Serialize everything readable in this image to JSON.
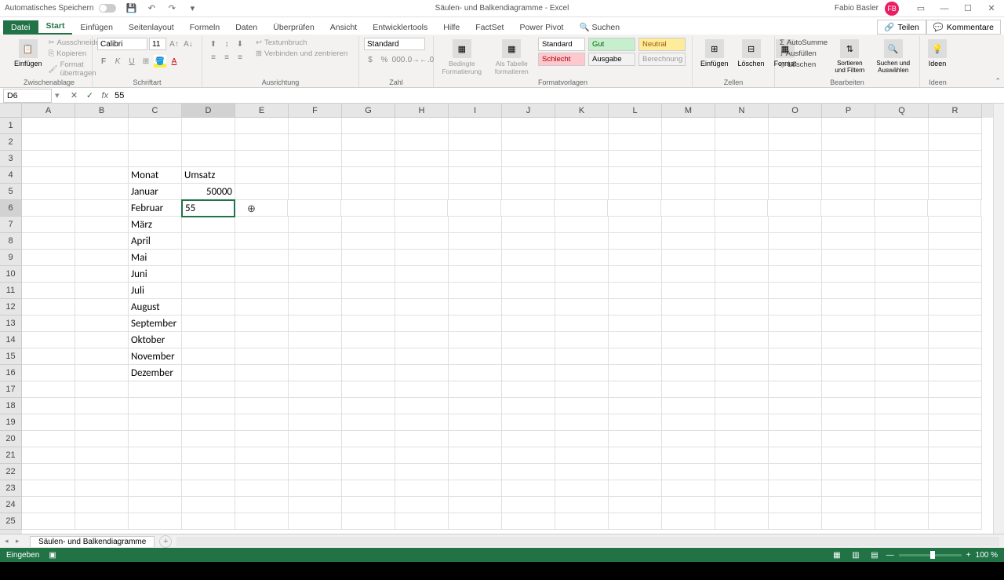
{
  "titlebar": {
    "autosave": "Automatisches Speichern",
    "doc_title": "Säulen- und Balkendiagramme - Excel",
    "user_name": "Fabio Basler",
    "user_initials": "FB"
  },
  "tabs": {
    "file": "Datei",
    "items": [
      "Start",
      "Einfügen",
      "Seitenlayout",
      "Formeln",
      "Daten",
      "Überprüfen",
      "Ansicht",
      "Entwicklertools",
      "Hilfe",
      "FactSet",
      "Power Pivot"
    ],
    "search_icon": "🔍",
    "search": "Suchen",
    "share": "Teilen",
    "comments": "Kommentare"
  },
  "ribbon": {
    "clipboard": {
      "label": "Zwischenablage",
      "paste": "Einfügen",
      "cut": "Ausschneiden",
      "copy": "Kopieren",
      "format": "Format übertragen"
    },
    "font": {
      "label": "Schriftart",
      "name": "Calibri",
      "size": "11"
    },
    "align": {
      "label": "Ausrichtung",
      "wrap": "Textumbruch",
      "merge": "Verbinden und zentrieren"
    },
    "number": {
      "label": "Zahl",
      "format": "Standard"
    },
    "styles": {
      "label": "Formatvorlagen",
      "cond": "Bedingte Formatierung",
      "table": "Als Tabelle formatieren",
      "standard": "Standard",
      "schlecht": "Schlecht",
      "gut": "Gut",
      "ausgabe": "Ausgabe",
      "neutral": "Neutral",
      "berechnung": "Berechnung"
    },
    "cells": {
      "label": "Zellen",
      "insert": "Einfügen",
      "delete": "Löschen",
      "format": "Format"
    },
    "editing": {
      "label": "Bearbeiten",
      "autosum": "AutoSumme",
      "fill": "Ausfüllen",
      "clear": "Löschen",
      "sort": "Sortieren und Filtern",
      "find": "Suchen und Auswählen"
    },
    "ideas": {
      "label": "Ideen",
      "btn": "Ideen"
    }
  },
  "formula_bar": {
    "name_box": "D6",
    "formula": "55"
  },
  "columns": [
    "A",
    "B",
    "C",
    "D",
    "E",
    "F",
    "G",
    "H",
    "I",
    "J",
    "K",
    "L",
    "M",
    "N",
    "O",
    "P",
    "Q",
    "R"
  ],
  "rows": [
    "1",
    "2",
    "3",
    "4",
    "5",
    "6",
    "7",
    "8",
    "9",
    "10",
    "11",
    "12",
    "13",
    "14",
    "15",
    "16",
    "17",
    "18",
    "19",
    "20",
    "21",
    "22",
    "23",
    "24",
    "25"
  ],
  "active": {
    "col": "D",
    "row": "6"
  },
  "data": {
    "C4": "Monat",
    "D4": "Umsatz",
    "C5": "Januar",
    "D5": "50000",
    "C6": "Februar",
    "D6": "55",
    "C7": "März",
    "C8": "April",
    "C9": "Mai",
    "C10": "Juni",
    "C11": "Juli",
    "C12": "August",
    "C13": "September",
    "C14": "Oktober",
    "C15": "November",
    "C16": "Dezember"
  },
  "sheet": {
    "name": "Säulen- und Balkendiagramme"
  },
  "status": {
    "mode": "Eingeben",
    "zoom": "100 %"
  }
}
